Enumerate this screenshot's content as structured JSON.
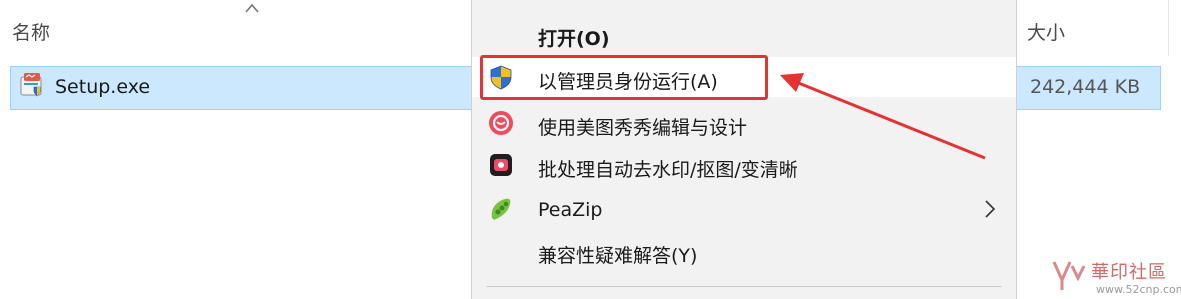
{
  "header": {
    "name_label": "名称",
    "size_label": "大小"
  },
  "file": {
    "name": "Setup.exe",
    "size": "242,444 KB"
  },
  "context_menu": {
    "items": [
      {
        "label": "打开(O)",
        "bold": true
      },
      {
        "label": "以管理员身份运行(A)",
        "icon": "uac-shield-icon",
        "hovered": true
      },
      {
        "label": "使用美图秀秀编辑与设计",
        "icon": "meitu-icon"
      },
      {
        "label": "批处理自动去水印/抠图/变清晰",
        "icon": "batch-tool-icon"
      },
      {
        "label": "PeaZip",
        "icon": "peazip-icon",
        "submenu": true
      },
      {
        "label": "兼容性疑难解答(Y)"
      }
    ]
  },
  "annotation": {
    "color": "#e53232"
  },
  "watermark": {
    "logo_text": "華印社區",
    "url": "www.52cnp.com"
  }
}
